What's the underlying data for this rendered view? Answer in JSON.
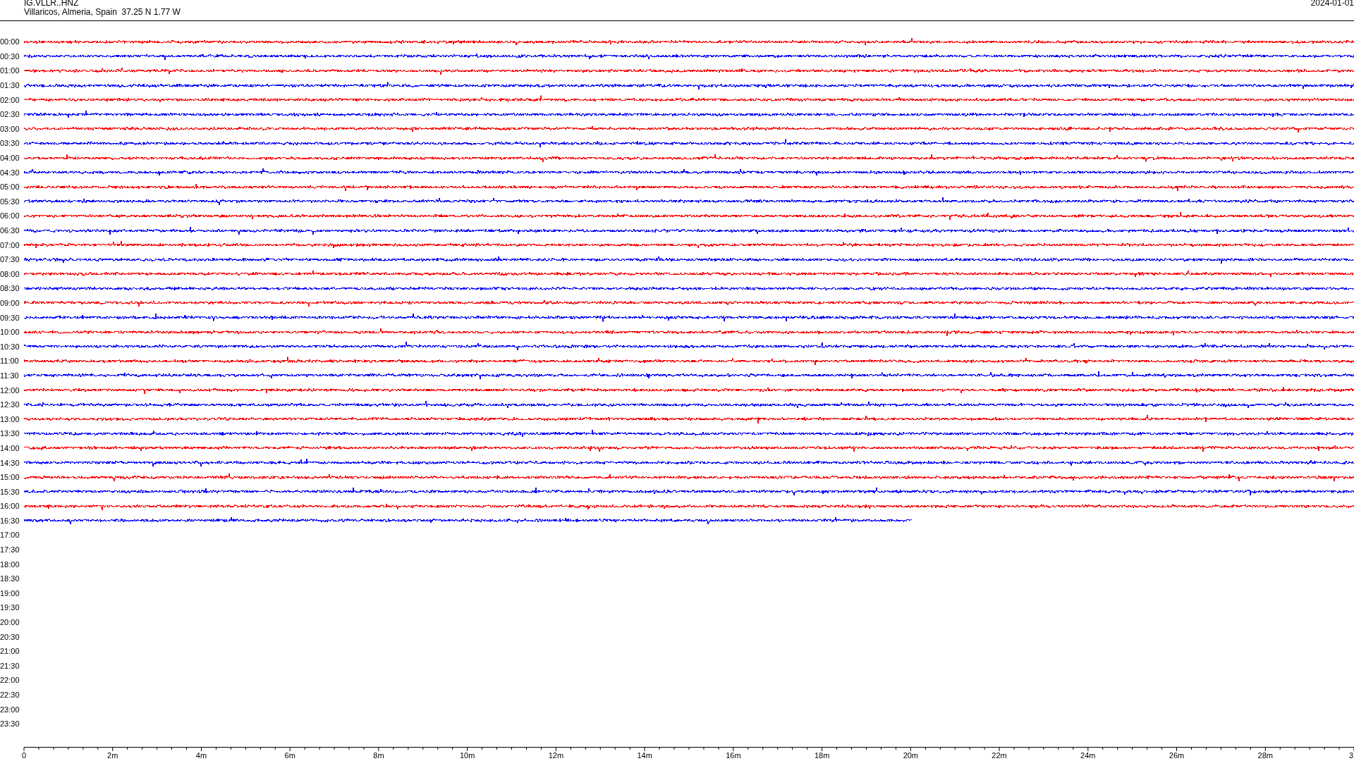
{
  "header": {
    "station": "IG.VLLR..HNZ",
    "location": "Villaricos, Almeria, Spain  37.25 N 1.77 W",
    "date": "2024-01-01"
  },
  "rows": [
    {
      "time": "00:00",
      "kind": "full",
      "color": "#ff0000"
    },
    {
      "time": "00:30",
      "kind": "full",
      "color": "#0000ff"
    },
    {
      "time": "01:00",
      "kind": "full",
      "color": "#ff0000"
    },
    {
      "time": "01:30",
      "kind": "full",
      "color": "#0000ff"
    },
    {
      "time": "02:00",
      "kind": "full",
      "color": "#ff0000"
    },
    {
      "time": "02:30",
      "kind": "full",
      "color": "#0000ff"
    },
    {
      "time": "03:00",
      "kind": "full",
      "color": "#ff0000"
    },
    {
      "time": "03:30",
      "kind": "full",
      "color": "#0000ff"
    },
    {
      "time": "04:00",
      "kind": "full",
      "color": "#ff0000"
    },
    {
      "time": "04:30",
      "kind": "full",
      "color": "#0000ff"
    },
    {
      "time": "05:00",
      "kind": "full",
      "color": "#ff0000"
    },
    {
      "time": "05:30",
      "kind": "full",
      "color": "#0000ff"
    },
    {
      "time": "06:00",
      "kind": "full",
      "color": "#ff0000"
    },
    {
      "time": "06:30",
      "kind": "full",
      "color": "#0000ff"
    },
    {
      "time": "07:00",
      "kind": "full",
      "color": "#ff0000"
    },
    {
      "time": "07:30",
      "kind": "full",
      "color": "#0000ff"
    },
    {
      "time": "08:00",
      "kind": "full",
      "color": "#ff0000"
    },
    {
      "time": "08:30",
      "kind": "full",
      "color": "#0000ff"
    },
    {
      "time": "09:00",
      "kind": "full",
      "color": "#ff0000"
    },
    {
      "time": "09:30",
      "kind": "full",
      "color": "#0000ff"
    },
    {
      "time": "10:00",
      "kind": "full",
      "color": "#ff0000"
    },
    {
      "time": "10:30",
      "kind": "full",
      "color": "#0000ff"
    },
    {
      "time": "11:00",
      "kind": "full",
      "color": "#ff0000"
    },
    {
      "time": "11:30",
      "kind": "full",
      "color": "#0000ff"
    },
    {
      "time": "12:00",
      "kind": "full",
      "color": "#ff0000"
    },
    {
      "time": "12:30",
      "kind": "full",
      "color": "#0000ff"
    },
    {
      "time": "13:00",
      "kind": "full",
      "color": "#ff0000"
    },
    {
      "time": "13:30",
      "kind": "full",
      "color": "#0000ff"
    },
    {
      "time": "14:00",
      "kind": "full",
      "color": "#ff0000"
    },
    {
      "time": "14:30",
      "kind": "full",
      "color": "#0000ff"
    },
    {
      "time": "15:00",
      "kind": "full",
      "color": "#ff0000"
    },
    {
      "time": "15:30",
      "kind": "full",
      "color": "#0000ff"
    },
    {
      "time": "16:00",
      "kind": "full",
      "color": "#ff0000"
    },
    {
      "time": "16:30",
      "kind": "partial",
      "color": "#0000ff",
      "level": 0.668
    },
    {
      "time": "17:00",
      "kind": "none"
    },
    {
      "time": "17:30",
      "kind": "none"
    },
    {
      "time": "18:00",
      "kind": "none"
    },
    {
      "time": "18:30",
      "kind": "none"
    },
    {
      "time": "19:00",
      "kind": "none"
    },
    {
      "time": "19:30",
      "kind": "none"
    },
    {
      "time": "20:00",
      "kind": "none"
    },
    {
      "time": "20:30",
      "kind": "none"
    },
    {
      "time": "21:00",
      "kind": "none"
    },
    {
      "time": "21:30",
      "kind": "none"
    },
    {
      "time": "22:00",
      "kind": "none"
    },
    {
      "time": "22:30",
      "kind": "none"
    },
    {
      "time": "23:00",
      "kind": "none"
    },
    {
      "time": "23:30",
      "kind": "none"
    }
  ],
  "x_axis": {
    "labels": [
      "0",
      "2m",
      "4m",
      "6m",
      "8m",
      "10m",
      "12m",
      "14m",
      "16m",
      "18m",
      "20m",
      "22m",
      "24m",
      "26m",
      "28m",
      "3"
    ]
  }
}
